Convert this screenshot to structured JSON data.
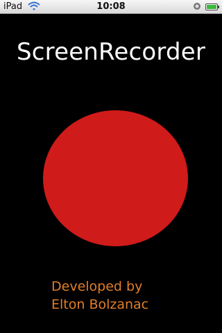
{
  "status_bar": {
    "carrier": "iPad",
    "time": "10:08",
    "wifi_icon": "wifi-icon",
    "lock_icon": "rotation-lock-icon",
    "battery_icon": "battery-icon"
  },
  "app": {
    "title": "ScreenRecorder",
    "record_button_color": "#cf1b1a",
    "credit_line1": "Developed by",
    "credit_line2": "Elton Bolzanac",
    "credit_color": "#e07f2b"
  }
}
